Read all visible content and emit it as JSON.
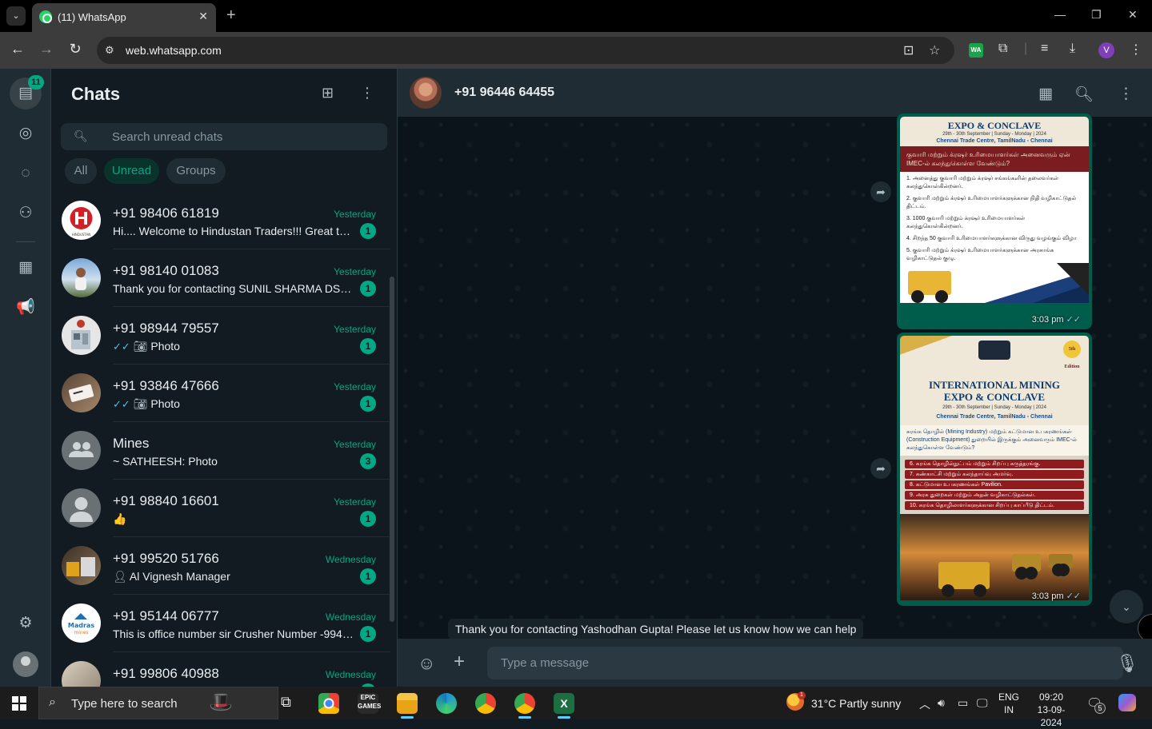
{
  "browser": {
    "tab_title": "(11) WhatsApp",
    "url": "web.whatsapp.com",
    "profile_initial": "V",
    "extension_label": "WA"
  },
  "rail": {
    "unread_count": "11"
  },
  "sidebar": {
    "title": "Chats",
    "search_placeholder": "Search unread chats",
    "filters": [
      "All",
      "Unread",
      "Groups"
    ],
    "active_filter": "Unread"
  },
  "chats": [
    {
      "name": "+91 98406 61819",
      "time": "Yesterday",
      "preview": "Hi.... Welcome to Hindustan Traders!!! Great to see you here!",
      "unread": "1",
      "avatar": "hindustan-logo"
    },
    {
      "name": "+91 98140 01083",
      "time": "Yesterday",
      "preview": "Thank you for contacting SUNIL SHARMA DS MECHANICAL WORKS",
      "unread": "1",
      "avatar": "photo"
    },
    {
      "name": "+91 98944 79557",
      "time": "Yesterday",
      "preview": "Photo",
      "unread": "1",
      "avatar": "photo",
      "ticks": true,
      "photo": true
    },
    {
      "name": "+91 93846 47666",
      "time": "Yesterday",
      "preview": "Photo",
      "unread": "1",
      "avatar": "photo",
      "ticks": true,
      "photo": true
    },
    {
      "name": "Mines",
      "time": "Yesterday",
      "preview": "~ SATHEESH: Photo",
      "unread": "3",
      "avatar": "group"
    },
    {
      "name": "+91 98840 16601",
      "time": "Yesterday",
      "preview": "👍",
      "unread": "1",
      "avatar": "default"
    },
    {
      "name": "+91 99520 51766",
      "time": "Wednesday",
      "preview": "Al Vignesh Manager",
      "unread": "1",
      "avatar": "photo",
      "contact": true
    },
    {
      "name": "+91 95144 06777",
      "time": "Wednesday",
      "preview": "This is office number sir Crusher Number -9944406777",
      "unread": "1",
      "avatar": "madras-logo"
    },
    {
      "name": "+91 99806 40988",
      "time": "Wednesday",
      "preview": "",
      "unread": "1",
      "avatar": "photo"
    }
  ],
  "conversation": {
    "contact_name": "+91 96446 64455",
    "messages": [
      {
        "type": "image",
        "time": "3:03 pm",
        "poster": {
          "heading": "EXPO & CONCLAVE",
          "dates": "29th - 30th September | Sunday - Monday | 2024",
          "venue": "Chennai Trade Centre, TamilNadu - Chennai",
          "question": "குவாரி மற்றும் க்ரஷர் உரிமையாளர்கள் அனைவரும் ஏன் IMEC-ல் கலந்துகொள்ள வேண்டும்?",
          "points": [
            "1. அனைத்து குவாரி மற்றும் க்ரஷர் சங்கங்களின் தலைவர்கள் கலந்துகொள்கின்றனர்.",
            "2. குவாரி மற்றும் க்ரஷர் உரிமையாளர்களுக்கான நிதி வழிகாட்டுதல் திட்டம்.",
            "3. 1000 குவாரி மற்றும் க்ரஷர் உரிமையாளர்கள் கலந்துகொள்கின்றனர்.",
            "4. சிறந்த 50 குவாரி உரிமையாளர்களுக்கான விருது வழங்கும் விழா",
            "5. குவாரி மற்றும் க்ரஷர் உரிமையாளர்களுக்கான அரசாங்க வழிகாட்டுதல் குழு."
          ]
        }
      },
      {
        "type": "image",
        "time": "3:03 pm",
        "poster": {
          "edition": "5th Edition",
          "title_line1": "INTERNATIONAL MINING",
          "title_line2": "EXPO & CONCLAVE",
          "dates": "29th - 30th September | Sunday - Monday | 2024",
          "venue": "Chennai Trade Centre, TamilNadu - Chennai",
          "question": "சுரங்க தொழில் (Mining Industry) மற்றும் கட்டுமான உபகரணங்கள் (Construction Equipment) துறையில் இருக்கும் அனைவரும் IMEC-ல் கலந்துகொள்ள வேண்டும்?",
          "points": [
            "6. சுரங்க தொழில்நுட்பம் மற்றும் சிறப்பு கருத்தரங்கு.",
            "7. கண்காட்சி மற்றும் கலந்தாய்வு அமர்வு.",
            "8. கட்டுமான உபகரணங்கள் Pavilion.",
            "9. அரசு துறைகள் மற்றும் அதன் வழிகாட்டுதல்கள்.",
            "10. சுரங்க தொழிலாளர்களுக்கான சிறப்பு காப்பீடு திட்டம்."
          ]
        }
      }
    ],
    "business_banner": "Thank you for contacting Yashodhan Gupta! Please let us know how we can help",
    "input_placeholder": "Type a message"
  },
  "taskbar": {
    "search_text": "Type here to search",
    "weather": "31°C  Partly sunny",
    "weather_alert": "1",
    "lang_line1": "ENG",
    "lang_line2": "IN",
    "time": "09:20",
    "date": "13-09-2024",
    "notifications": "5"
  },
  "colors": {
    "accent": "#00a884",
    "panel": "#202c33",
    "background": "#111b21",
    "outgoing_bubble": "#005c4b"
  }
}
